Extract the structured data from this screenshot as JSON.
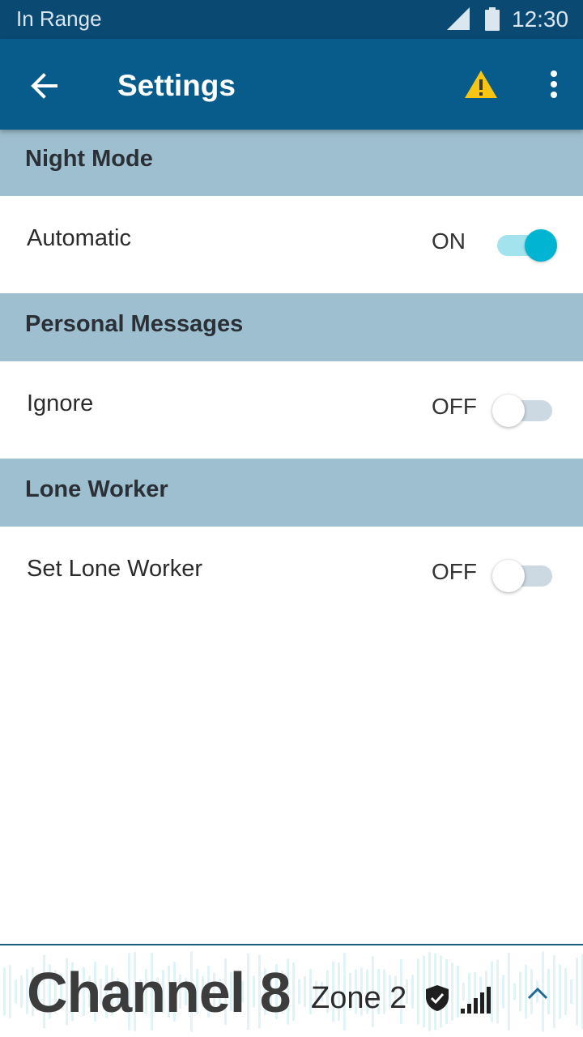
{
  "status_bar": {
    "network_label": "In Range",
    "time": "12:30",
    "signal_icon": "cell-signal-icon",
    "battery_icon": "battery-icon"
  },
  "app_bar": {
    "title": "Settings",
    "back_icon": "arrow-back-icon",
    "warning_icon": "warning-icon",
    "more_icon": "more-vert-icon",
    "warning_color": "#F9C513"
  },
  "sections": [
    {
      "title": "Night Mode",
      "setting": {
        "label": "Automatic",
        "state": "ON",
        "enabled": true
      }
    },
    {
      "title": "Personal Messages",
      "setting": {
        "label": "Ignore",
        "state": "OFF",
        "enabled": false
      }
    },
    {
      "title": "Lone Worker",
      "setting": {
        "label": "Set Lone Worker",
        "state": "OFF",
        "enabled": false
      }
    }
  ],
  "bottom_bar": {
    "channel": "Channel 8",
    "zone": "Zone 2",
    "shield_icon": "shield-check-icon",
    "signal_icon": "signal-bars-icon",
    "expand_icon": "chevron-up-icon"
  },
  "colors": {
    "status_bar": "#0A4A72",
    "app_bar": "#075C8B",
    "section_header": "#9EBFD0",
    "toggle_on": "#00B4D2",
    "toggle_on_track": "#A3E3ED",
    "toggle_off_track": "#CDD9E2"
  }
}
